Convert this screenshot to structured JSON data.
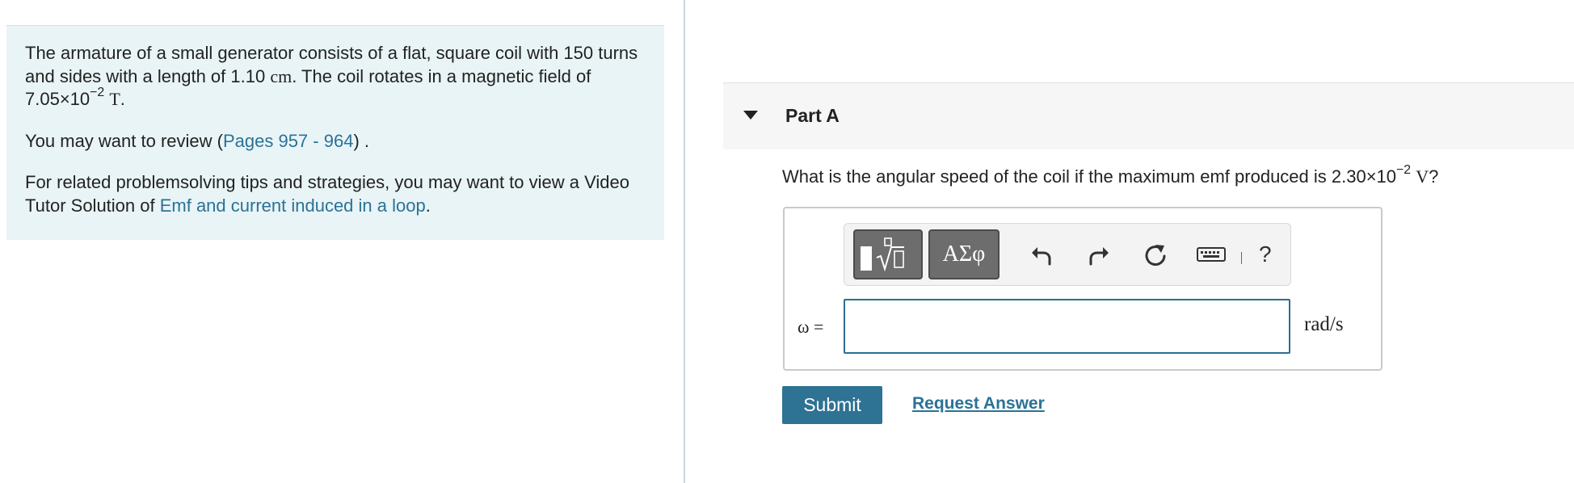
{
  "problem": {
    "statement_text": "The armature of a small generator consists of a flat, square coil with 150 turns and sides with a length of 1.10",
    "statement_unit_cm": "cm",
    "statement_text2": ". The coil rotates in a magnetic field of 7.05×10",
    "statement_exp": "−2",
    "statement_unit_T": "T",
    "statement_end": ".",
    "review_prefix": "You may want to review (",
    "review_link": "Pages 957 - 964",
    "review_suffix": ") .",
    "tips_text": "For related problemsolving tips and strategies, you may want to view a Video Tutor Solution of ",
    "tips_link": "Emf and current induced in a loop",
    "tips_suffix": "."
  },
  "part": {
    "title": "Part A",
    "question_text": "What is the angular speed of the coil if the maximum emf produced is 2.30×10",
    "question_exp": "−2",
    "question_unit": "V",
    "question_end": "?"
  },
  "toolbar": {
    "symbols_label": "ΑΣφ",
    "help_label": "?",
    "icons": [
      "templates-icon",
      "symbols-icon",
      "undo-icon",
      "redo-icon",
      "reset-icon",
      "keyboard-icon",
      "help-icon"
    ]
  },
  "answer": {
    "variable_label": "ω =",
    "input_value": "",
    "unit": "rad/s"
  },
  "actions": {
    "submit_label": "Submit",
    "request_label": "Request Answer"
  },
  "colors": {
    "accent": "#2e7294",
    "link": "#2a7297",
    "problem_bg": "#e9f4f6"
  }
}
